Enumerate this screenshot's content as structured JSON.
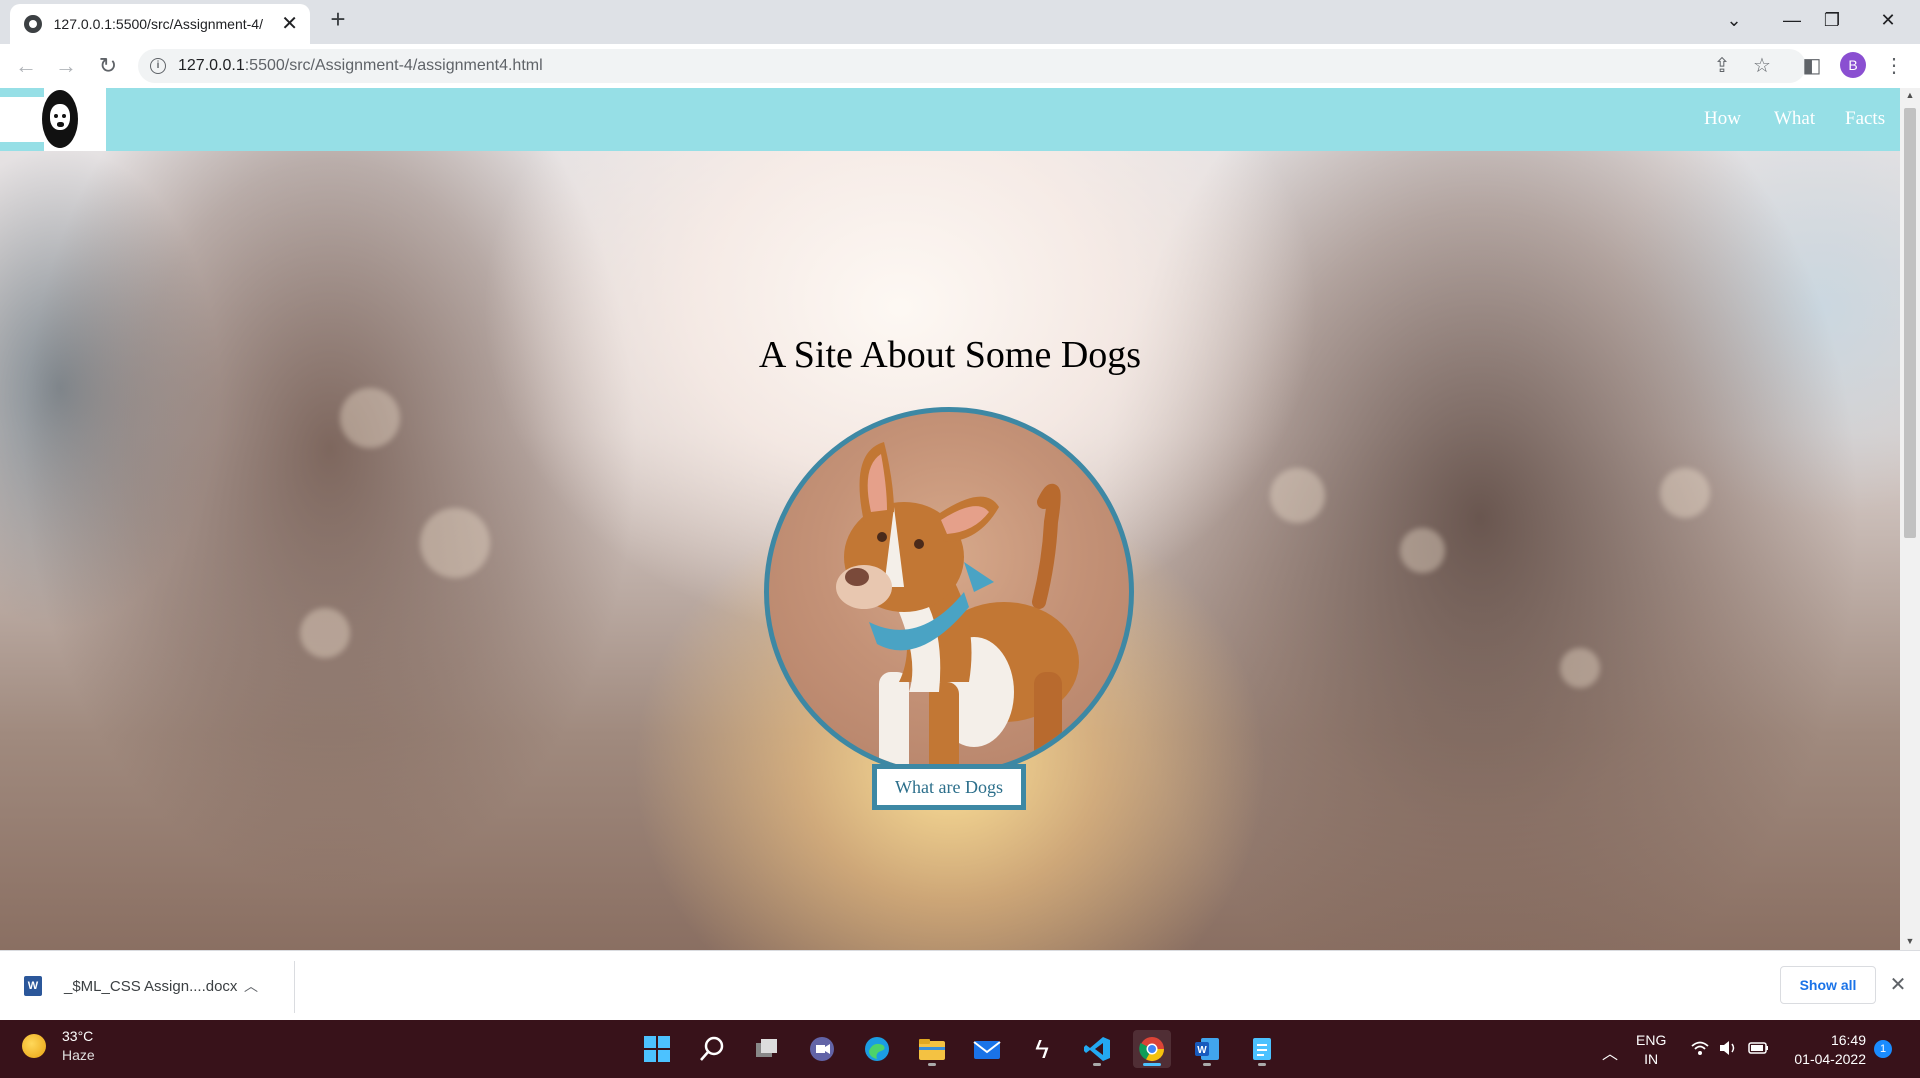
{
  "browser": {
    "tab_title": "127.0.0.1:5500/src/Assignment-4/",
    "url_host": "127.0.0.1",
    "url_rest": ":5500/src/Assignment-4/assignment4.html",
    "profile_initial": "B"
  },
  "site": {
    "nav": [
      "How",
      "What",
      "Facts"
    ],
    "title": "A Site About Some Dogs",
    "button_label": "What are Dogs",
    "accent_color": "#3d88a4",
    "nav_color": "#96dfe6"
  },
  "downloads": {
    "file_name": "_$ML_CSS Assign....docx",
    "show_all": "Show all"
  },
  "taskbar": {
    "temperature": "33°C",
    "condition": "Haze",
    "language_1": "ENG",
    "language_2": "IN",
    "time": "16:49",
    "date": "01-04-2022",
    "notification_count": "1",
    "apps": [
      "windows-start-icon",
      "search-icon",
      "task-view-icon",
      "teams-chat-icon",
      "edge-icon",
      "file-explorer-icon",
      "mail-icon",
      "sublime-icon",
      "vscode-icon",
      "chrome-icon",
      "word-icon",
      "notepad-icon"
    ]
  }
}
